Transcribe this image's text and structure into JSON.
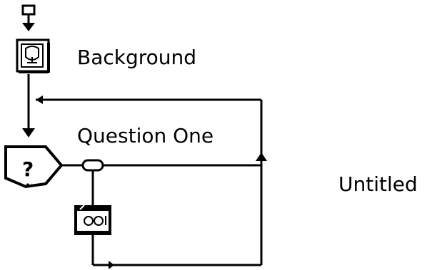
{
  "diagram": {
    "nodes": {
      "start": {
        "label": "",
        "icon": "flowline-start-icon"
      },
      "background": {
        "label": "Background",
        "icon": "display-icon"
      },
      "question": {
        "label": "Question One",
        "icon": "interaction-decision-icon"
      },
      "response": {
        "label": "",
        "icon": "response-branch-icon"
      },
      "calculation": {
        "label": "",
        "icon": "calculation-icon"
      }
    },
    "side_label": "Untitled",
    "colors": {
      "line": "#000000",
      "background": "#ffffff"
    }
  }
}
